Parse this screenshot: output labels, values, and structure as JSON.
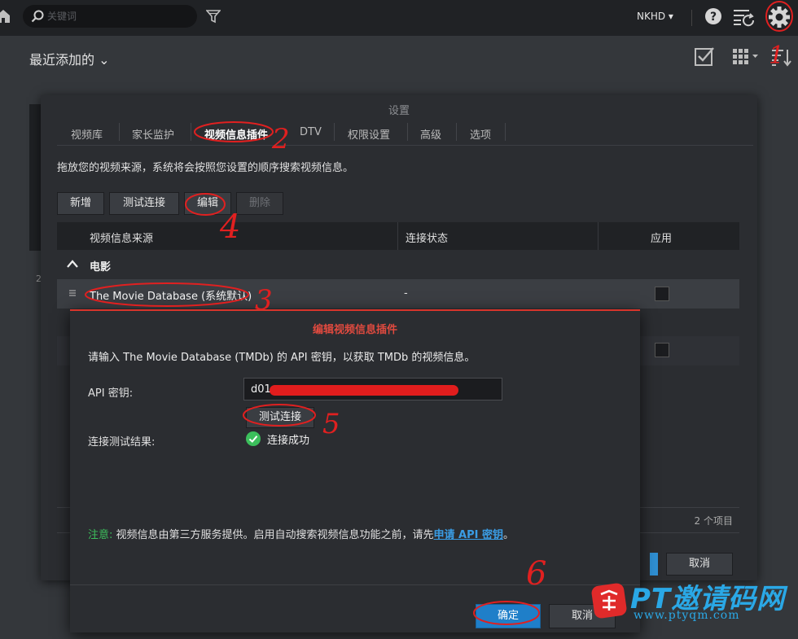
{
  "topbar": {
    "search_placeholder": "关键词",
    "user_label": "NKHD ▾"
  },
  "main": {
    "title": "最近添加的 ⌄",
    "poster_caption": "2"
  },
  "settings": {
    "title": "设置",
    "tabs": [
      "视频库",
      "家长监护",
      "视频信息插件",
      "DTV",
      "权限设置",
      "高级",
      "选项"
    ],
    "active_tab": "视频信息插件",
    "description": "拖放您的视频来源，系统将会按照您设置的顺序搜索视频信息。",
    "buttons": {
      "add": "新增",
      "test": "测试连接",
      "edit": "编辑",
      "delete": "删除"
    },
    "table": {
      "headers": [
        "视频信息来源",
        "连接状态",
        "应用"
      ],
      "group": "电影",
      "rows": [
        {
          "source": "The Movie Database (系统默认)",
          "status": "-"
        }
      ]
    },
    "item_count": "2 个项目",
    "cancel": "取消"
  },
  "plugin_dialog": {
    "title": "编辑视频信息插件",
    "description": "请输入 The Movie Database (TMDb) 的 API 密钥，以获取 TMDb 的视频信息。",
    "api_key_label": "API 密钥:",
    "api_key_value": "d01",
    "test_button": "测试连接",
    "result_label": "连接测试结果:",
    "result_text": "连接成功",
    "notice_prefix": "注意:",
    "notice_body": " 视频信息由第三方服务提供。启用自动搜索视频信息功能之前，请先",
    "notice_link": "申请 API 密钥",
    "notice_end": "。",
    "ok": "确定",
    "cancel": "取消"
  },
  "watermark": {
    "brand": "PT邀请码网",
    "url": "www.ptyqm.com"
  },
  "annotations": [
    "1",
    "2",
    "3",
    "4",
    "5",
    "6"
  ],
  "colors": {
    "accent": "#1f7fc9",
    "dialog_title": "#e04a3f",
    "success": "#3cbf5c",
    "annotation": "#e02020"
  }
}
